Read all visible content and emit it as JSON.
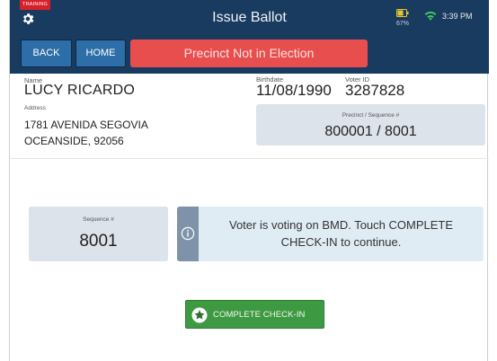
{
  "header": {
    "training_badge": "TRAINING",
    "title": "Issue Ballot",
    "battery_percent": "67%",
    "battery_level": 0.67,
    "time": "3:39 PM"
  },
  "nav": {
    "back_label": "BACK",
    "home_label": "HOME",
    "alert_text": "Precinct Not in Election"
  },
  "voter": {
    "name_label": "Name",
    "name": "LUCY RICARDO",
    "birthdate_label": "Birthdate",
    "birthdate": "11/08/1990",
    "voter_id_label": "Voter ID",
    "voter_id": "3287828",
    "address_label": "Address",
    "address_line1": "1781 AVENIDA SEGOVIA",
    "address_line2": "OCEANSIDE, 92056",
    "precinct_label": "Precinct / Sequence #",
    "precinct_value": "800001 / 8001"
  },
  "sequence": {
    "label": "Sequence #",
    "value": "8001"
  },
  "info": {
    "line1": "Voter is voting on BMD. Touch COMPLETE",
    "line2": "CHECK-IN to continue."
  },
  "action": {
    "complete_label": "COMPLETE CHECK-IN"
  },
  "colors": {
    "header_bg": "#183b5f",
    "nav_button": "#2d6da8",
    "alert": "#e84e4e",
    "training": "#d6212a",
    "panel": "#dde3eb",
    "info_bg": "#e0ecf4",
    "info_strip": "#7e93aa",
    "complete_button": "#3e9a42"
  },
  "icons": {
    "settings": "gear-icon",
    "battery": "battery-icon",
    "wifi": "wifi-icon",
    "info": "info-icon",
    "complete": "star-circle-icon"
  }
}
